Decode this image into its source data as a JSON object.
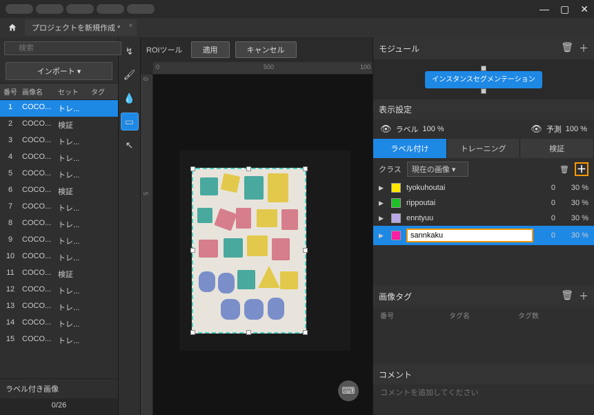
{
  "window": {
    "title": "プロジェクトを新規作成 *"
  },
  "left": {
    "search_placeholder": "検索",
    "import_label": "インポート ▾",
    "columns": {
      "num": "番号",
      "name": "画像名",
      "set": "セット",
      "tag": "タグ"
    },
    "rows": [
      {
        "num": "1",
        "name": "COCO...",
        "set": "トレ..."
      },
      {
        "num": "2",
        "name": "COCO...",
        "set": "検証"
      },
      {
        "num": "3",
        "name": "COCO...",
        "set": "トレ..."
      },
      {
        "num": "4",
        "name": "COCO...",
        "set": "トレ..."
      },
      {
        "num": "5",
        "name": "COCO...",
        "set": "トレ..."
      },
      {
        "num": "6",
        "name": "COCO...",
        "set": "検証"
      },
      {
        "num": "7",
        "name": "COCO...",
        "set": "トレ..."
      },
      {
        "num": "8",
        "name": "COCO...",
        "set": "トレ..."
      },
      {
        "num": "9",
        "name": "COCO...",
        "set": "トレ..."
      },
      {
        "num": "10",
        "name": "COCO...",
        "set": "トレ..."
      },
      {
        "num": "11",
        "name": "COCO...",
        "set": "検証"
      },
      {
        "num": "12",
        "name": "COCO...",
        "set": "トレ..."
      },
      {
        "num": "13",
        "name": "COCO...",
        "set": "トレ..."
      },
      {
        "num": "14",
        "name": "COCO...",
        "set": "トレ..."
      },
      {
        "num": "15",
        "name": "COCO...",
        "set": "トレ..."
      }
    ],
    "labeled_images": "ラベル付き画像",
    "progress": "0/26"
  },
  "roi": {
    "label": "ROIツール",
    "apply": "適用",
    "cancel": "キャンセル"
  },
  "ruler": {
    "h1": "0",
    "h2": "500",
    "h3": "100",
    "v1": "0",
    "v2": "5"
  },
  "right": {
    "module_title": "モジュール",
    "node_label": "インスタンスセグメンテーション",
    "display_title": "表示設定",
    "label_text": "ラベル",
    "label_pct": "100 %",
    "pred_text": "予測",
    "pred_pct": "100 %",
    "tabs": {
      "label": "ラベル付け",
      "train": "トレーニング",
      "verify": "検証"
    },
    "class_label": "クラス",
    "class_scope": "現在の画像",
    "classes": [
      {
        "name": "tyokuhoutai",
        "color": "#ffe600",
        "count": "0",
        "pct": "30 %"
      },
      {
        "name": "rippoutai",
        "color": "#1fbf27",
        "count": "0",
        "pct": "30 %"
      },
      {
        "name": "enntyuu",
        "color": "#b8a8e6",
        "count": "0",
        "pct": "30 %"
      },
      {
        "name": "sannkaku",
        "color": "#ff1fa3",
        "count": "0",
        "pct": "30 %"
      }
    ],
    "tags_title": "画像タグ",
    "tags_cols": {
      "num": "番号",
      "name": "タグ名",
      "count": "タグ数"
    },
    "comment_title": "コメント",
    "comment_placeholder": "コメントを追加してください"
  }
}
